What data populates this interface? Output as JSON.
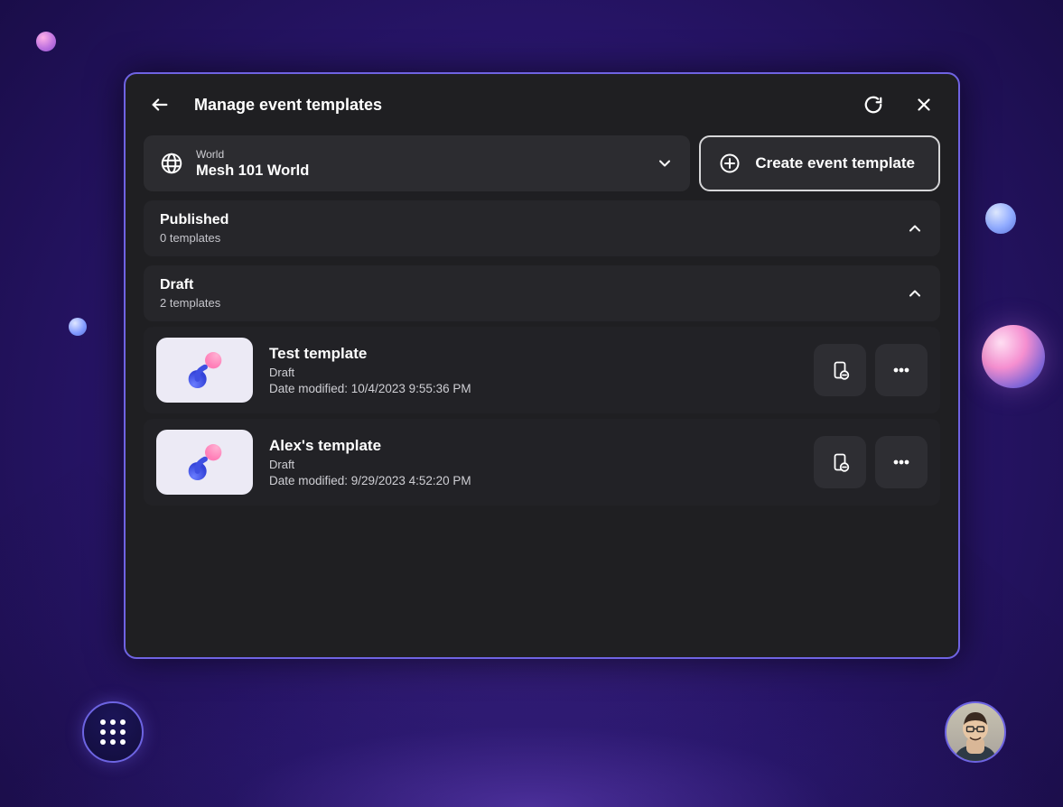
{
  "header": {
    "title": "Manage event templates"
  },
  "worldSelector": {
    "label": "World",
    "value": "Mesh 101 World"
  },
  "createButton": {
    "label": "Create event template"
  },
  "sections": {
    "published": {
      "title": "Published",
      "subtitle": "0 templates"
    },
    "draft": {
      "title": "Draft",
      "subtitle": "2 templates"
    }
  },
  "templates": [
    {
      "name": "Test template",
      "status": "Draft",
      "dateModifiedLabel": "Date modified: 10/4/2023 9:55:36 PM"
    },
    {
      "name": "Alex's template",
      "status": "Draft",
      "dateModifiedLabel": "Date modified: 9/29/2023 4:52:20 PM"
    }
  ]
}
